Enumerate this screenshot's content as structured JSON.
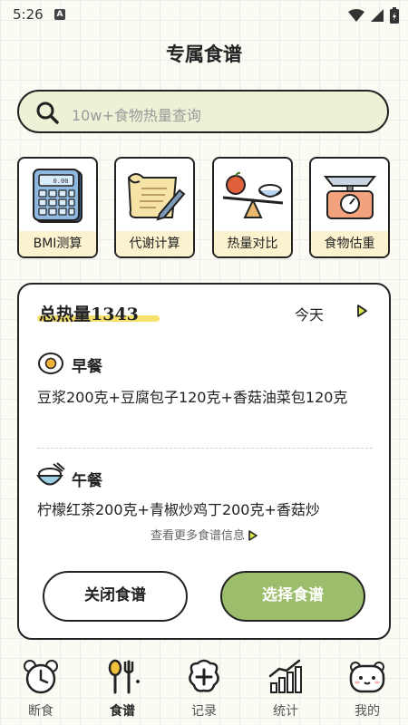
{
  "status": {
    "time": "5:26",
    "badge": "A"
  },
  "page": {
    "title": "专属食谱"
  },
  "search": {
    "placeholder": "10w+食物热量查询"
  },
  "tools": [
    {
      "label": "BMI测算",
      "icon": "calculator-icon"
    },
    {
      "label": "代谢计算",
      "icon": "scroll-pen-icon"
    },
    {
      "label": "热量对比",
      "icon": "balance-scale-icon"
    },
    {
      "label": "食物估重",
      "icon": "kitchen-scale-icon"
    }
  ],
  "recipe": {
    "total": "总热量1343",
    "date_label": "今天",
    "breakfast_title": "早餐",
    "breakfast_desc": "豆浆200克+豆腐包子120克+香菇油菜包120克",
    "lunch_title": "午餐",
    "lunch_desc": "柠檬红茶200克+青椒炒鸡丁200克+香菇炒",
    "more_label": "查看更多食谱信息",
    "close_label": "关闭食谱",
    "select_label": "选择食谱"
  },
  "tabs": [
    {
      "label": "断食",
      "active": false
    },
    {
      "label": "食谱",
      "active": true
    },
    {
      "label": "记录",
      "active": false
    },
    {
      "label": "统计",
      "active": false
    },
    {
      "label": "我的",
      "active": false
    }
  ],
  "colors": {
    "accent": "#9cbd6b",
    "search_bg": "#edf1d6",
    "label_bg": "#fbf2cf",
    "highlight": "#f4dc52"
  }
}
